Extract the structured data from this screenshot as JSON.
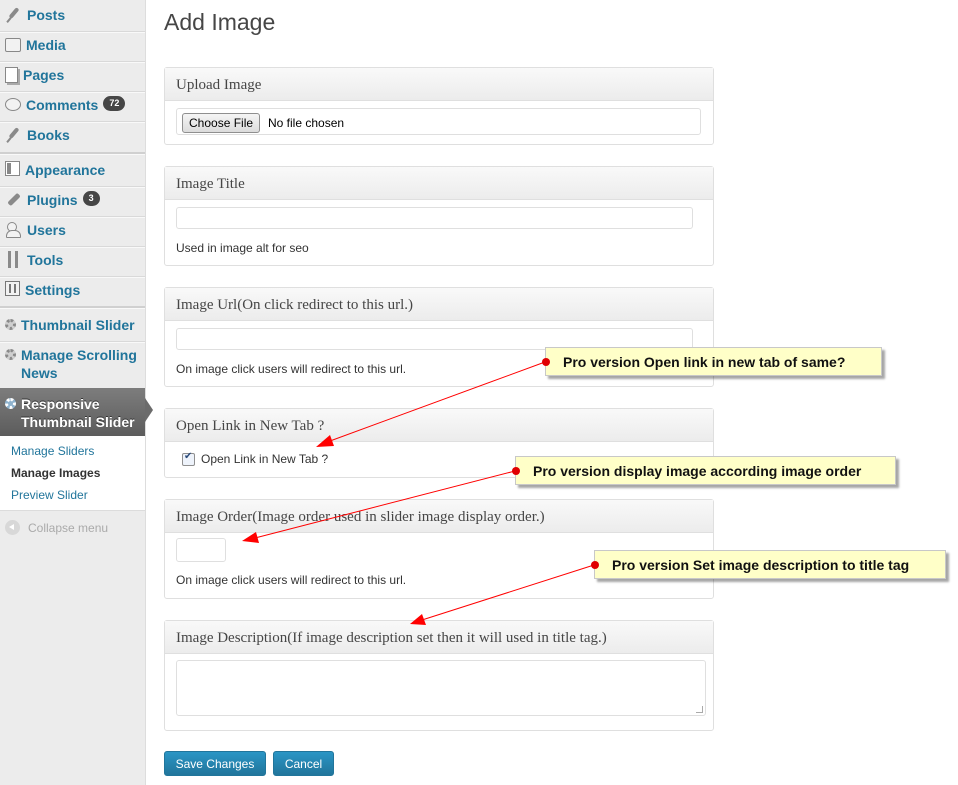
{
  "menu": {
    "items": [
      {
        "label": "Posts",
        "icon": "pin-icon"
      },
      {
        "label": "Media",
        "icon": "media-icon"
      },
      {
        "label": "Pages",
        "icon": "pages-icon"
      },
      {
        "label": "Comments",
        "icon": "comments-icon",
        "badge": "72"
      },
      {
        "label": "Books",
        "icon": "pin-icon"
      },
      {
        "label": "Appearance",
        "icon": "appearance-icon"
      },
      {
        "label": "Plugins",
        "icon": "plugins-icon",
        "badge": "3"
      },
      {
        "label": "Users",
        "icon": "users-icon"
      },
      {
        "label": "Tools",
        "icon": "tools-icon"
      },
      {
        "label": "Settings",
        "icon": "settings-icon"
      },
      {
        "label": "Thumbnail Slider",
        "icon": "gear-icon"
      },
      {
        "label_line1": "Manage Scrolling",
        "label_line2": "News",
        "icon": "gear-icon"
      }
    ],
    "active": {
      "label_line1": "Responsive",
      "label_line2": "Thumbnail Slider",
      "icon": "gear-icon"
    },
    "submenu": [
      "Manage Sliders",
      "Manage Images",
      "Preview Slider"
    ],
    "submenu_current": "Manage Images",
    "collapse": "Collapse menu"
  },
  "page": {
    "title": "Add Image"
  },
  "form": {
    "upload": {
      "heading": "Upload Image",
      "button": "Choose File",
      "status": "No file chosen"
    },
    "title": {
      "heading": "Image Title",
      "value": "",
      "hint": "Used in image alt for seo"
    },
    "url": {
      "heading": "Image Url(On click redirect to this url.)",
      "value": "",
      "hint": "On image click users will redirect to this url."
    },
    "newtab": {
      "heading": "Open Link in New Tab ?",
      "checkbox_label": "Open Link in New Tab ?",
      "checked": true
    },
    "order": {
      "heading": "Image Order(Image order used in slider image display order.)",
      "value": "",
      "hint": "On image click users will redirect to this url."
    },
    "description": {
      "heading": "Image Description(If image description set then it will used in title tag.)",
      "value": ""
    }
  },
  "buttons": {
    "save": "Save Changes",
    "cancel": "Cancel"
  },
  "callouts": [
    "Pro version Open link in new tab of same?",
    "Pro version display image according image order",
    "Pro version Set image description to title tag"
  ],
  "colors": {
    "link": "#21759b",
    "callout_bg": "#ffffc8",
    "arrow": "#ff0000",
    "button": "#21759b"
  }
}
